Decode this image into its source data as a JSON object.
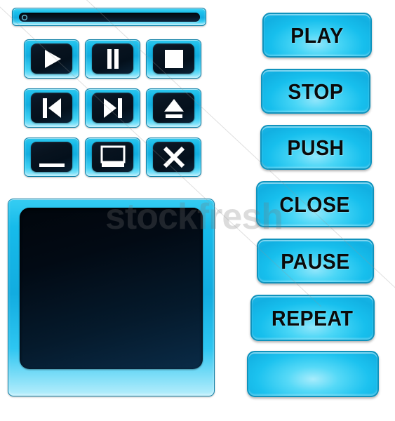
{
  "theme": {
    "background": "#ffffff",
    "bezel_cyan": "#17bbea",
    "bezel_cyan_light": "#8fe6fb",
    "bezel_border": "#0f93bd",
    "screen_dark": "#02101e",
    "label_color": "#0a0a0a"
  },
  "titlebar": {
    "name": "player-title-slot-bar",
    "led": "indicator-led"
  },
  "icon_buttons": [
    {
      "name": "play-button",
      "icon": "play-icon",
      "label": "Play"
    },
    {
      "name": "pause-button",
      "icon": "pause-icon",
      "label": "Pause"
    },
    {
      "name": "stop-button",
      "icon": "stop-icon",
      "label": "Stop"
    },
    {
      "name": "previous-button",
      "icon": "previous-track-icon",
      "label": "Previous"
    },
    {
      "name": "next-button",
      "icon": "next-track-icon",
      "label": "Next"
    },
    {
      "name": "eject-button",
      "icon": "eject-icon",
      "label": "Eject"
    },
    {
      "name": "minimize-button",
      "icon": "minimize-icon",
      "label": "Minimize"
    },
    {
      "name": "restore-button",
      "icon": "restore-window-icon",
      "label": "Restore"
    },
    {
      "name": "close-button",
      "icon": "close-x-icon",
      "label": "Close"
    }
  ],
  "display_panel": {
    "name": "display-screen-panel",
    "screen_content": ""
  },
  "text_buttons": [
    {
      "name": "play-text-button",
      "label": "PLAY"
    },
    {
      "name": "stop-text-button",
      "label": "STOP"
    },
    {
      "name": "push-text-button",
      "label": "PUSH"
    },
    {
      "name": "close-text-button",
      "label": "CLOSE"
    },
    {
      "name": "pause-text-button",
      "label": "PAUSE"
    },
    {
      "name": "repeat-text-button",
      "label": "REPEAT"
    },
    {
      "name": "blank-text-button",
      "label": ""
    }
  ],
  "watermark": {
    "primary": "stockfresh",
    "secondary": "sh"
  }
}
